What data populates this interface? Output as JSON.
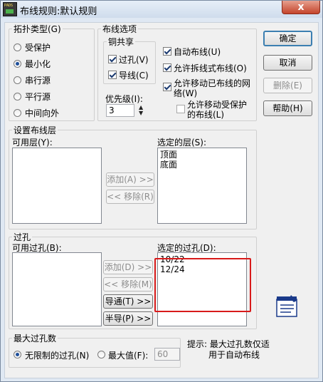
{
  "window": {
    "title": "布线规则:默认规则",
    "close_glyph": "x"
  },
  "topology": {
    "legend": "拓扑类型(G)",
    "options": [
      {
        "label": "受保护",
        "selected": false
      },
      {
        "label": "最小化",
        "selected": true
      },
      {
        "label": "串行源",
        "selected": false
      },
      {
        "label": "平行源",
        "selected": false
      },
      {
        "label": "中间向外",
        "selected": false
      }
    ]
  },
  "routing_options": {
    "legend": "布线选项",
    "copper_share": {
      "legend": "铜共享",
      "via_label": "过孔(V)",
      "via_checked": true,
      "wire_label": "导线(C)",
      "wire_checked": true
    },
    "auto_route_label": "自动布线(U)",
    "auto_route_checked": true,
    "split_label": "允许拆线式布线(O)",
    "split_checked": true,
    "move_routed_label": "允许移动已布线的网络(W)",
    "move_routed_checked": true,
    "move_protected_label": "允许移动受保护的布线(L)",
    "move_protected_checked": false,
    "priority_label": "优先级(I):",
    "priority_value": "3"
  },
  "buttons": {
    "ok": "确定",
    "cancel": "取消",
    "delete": "删除(E)",
    "help": "帮助(H)"
  },
  "layers": {
    "legend": "设置布线层",
    "available_label": "可用层(Y):",
    "available_items": [],
    "add": "添加(A) >>",
    "remove": "<< 移除(R)",
    "selected_label": "选定的层(S):",
    "selected_items": [
      "顶面",
      "底面"
    ]
  },
  "vias": {
    "legend": "过孔",
    "available_label": "可用过孔(B):",
    "available_items": [],
    "add": "添加(D) >>",
    "remove": "<< 移除(M)",
    "conduct": "导通(T) >>",
    "half": "半导(P) >>",
    "selected_label": "选定的过孔(D):",
    "selected_items": [
      "10/22",
      "12/24"
    ]
  },
  "max_vias": {
    "legend": "最大过孔数",
    "unlimited_label": "无限制的过孔(N)",
    "unlimited_selected": true,
    "max_label": "最大值(F):",
    "max_selected": false,
    "max_value": "60"
  },
  "hint": {
    "line1": "提示: 最大过孔数仅适",
    "line2": "用于自动布线"
  },
  "colors": {
    "highlight": "#d81a1a",
    "title_bar": "#dbe6f4",
    "close": "#c4442b"
  }
}
